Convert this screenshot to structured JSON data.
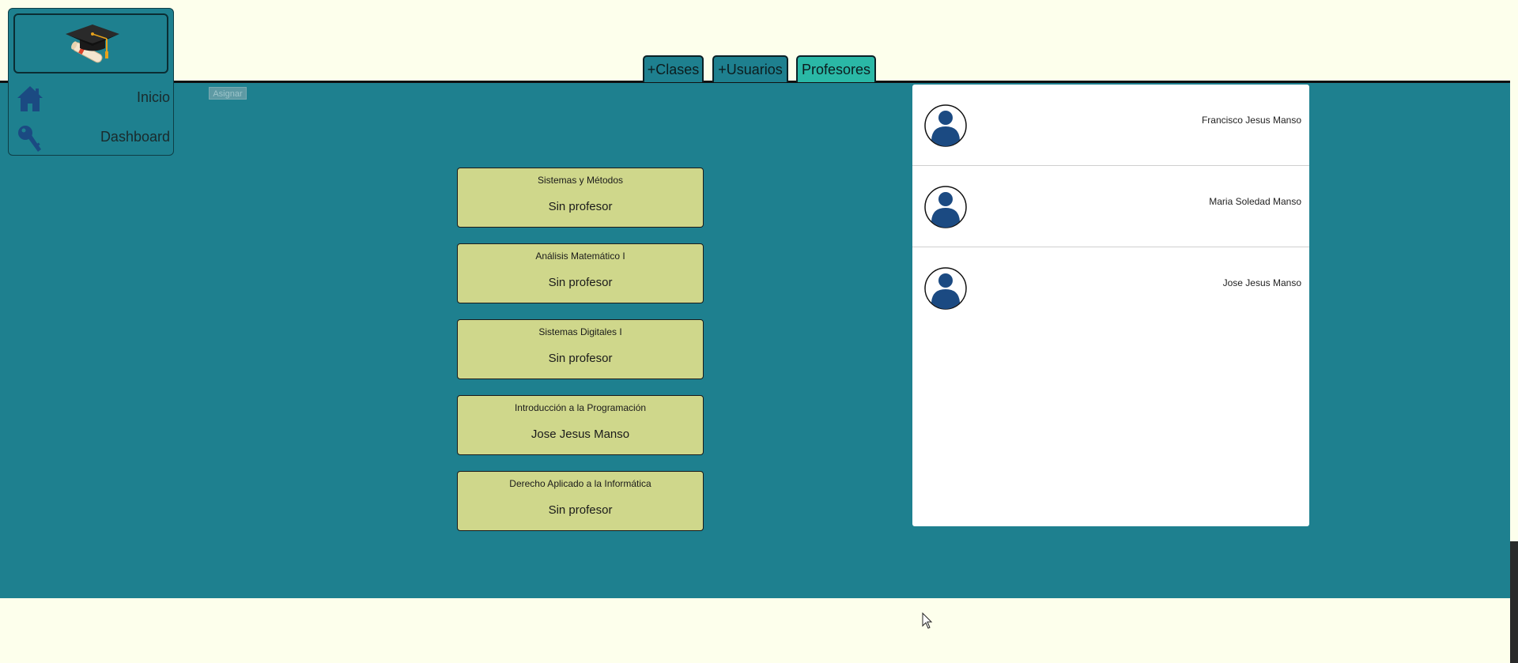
{
  "sidebar": {
    "items": [
      {
        "label": "Inicio",
        "icon": "home-icon"
      },
      {
        "label": "Dashboard",
        "icon": "key-icon"
      }
    ]
  },
  "tabs": [
    {
      "label": "+Clases",
      "active": false
    },
    {
      "label": "+Usuarios",
      "active": false
    },
    {
      "label": "Profesores",
      "active": true
    }
  ],
  "assign_button": {
    "label": "Asignar"
  },
  "classes": [
    {
      "title": "Sistemas y Métodos",
      "teacher": "Sin profesor"
    },
    {
      "title": "Análisis Matemático I",
      "teacher": "Sin profesor"
    },
    {
      "title": "Sistemas Digitales I",
      "teacher": "Sin profesor"
    },
    {
      "title": "Introducción a la Programación",
      "teacher": "Jose Jesus Manso"
    },
    {
      "title": "Derecho Aplicado a la Informática",
      "teacher": "Sin profesor"
    }
  ],
  "teachers": [
    {
      "name": "Francisco Jesus Manso"
    },
    {
      "name": "Maria Soledad Manso"
    },
    {
      "name": "Jose Jesus Manso"
    }
  ],
  "colors": {
    "page_bg": "#fdffec",
    "main_bg": "#1e808f",
    "tab_bg": "#1e808f",
    "tab_active_bg": "#2ab8a6",
    "card_bg": "#cfd78b",
    "icon_blue": "#1b4a82"
  }
}
